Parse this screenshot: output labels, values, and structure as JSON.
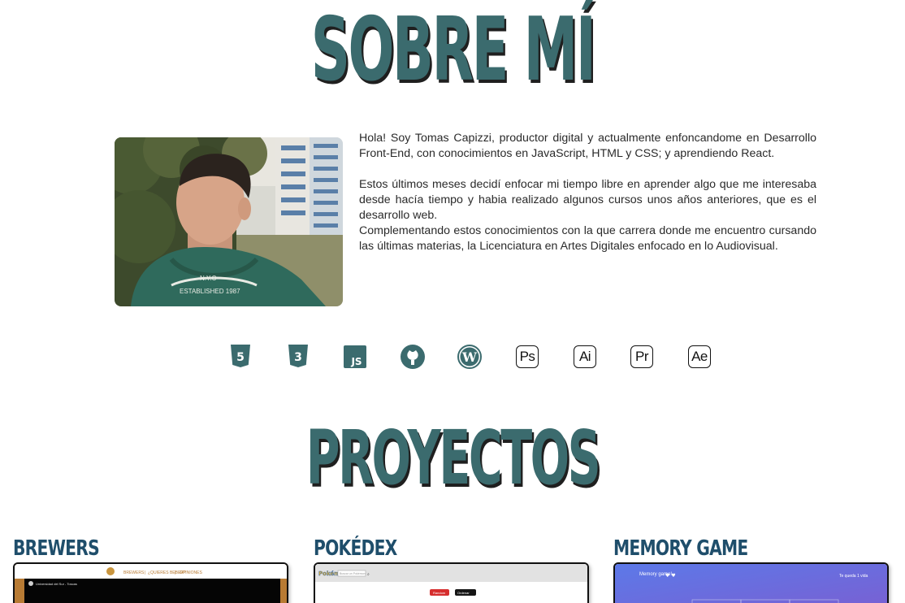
{
  "about": {
    "title": "SOBRE MÍ",
    "bio_paragraphs": [
      "Hola! Soy Tomas Capizzi, productor digital y actualmente enfoncandome en Desarrollo Front-End, con conocimientos en JavaScript, HTML y CSS; y aprendiendo React.",
      "Estos últimos meses decidí enfocar mi tiempo libre en aprender algo que me interesaba desde hacía tiempo y habia realizado algunos cursos unos años anteriores, que es el desarrollo web.",
      "Complementando estos conocimientos con la que carrera donde me encuentro cursando las últimas materias, la Licenciatura en Artes Digitales enfocado en lo Audiovisual."
    ],
    "photo_caption": {
      "line1": "N.Y.C",
      "line2": "ESTABLISHED 1987"
    }
  },
  "skills": [
    {
      "icon": "html5-icon",
      "label": "5"
    },
    {
      "icon": "css3-icon",
      "label": "3"
    },
    {
      "icon": "javascript-icon",
      "label": "JS"
    },
    {
      "icon": "github-icon",
      "label": ""
    },
    {
      "icon": "wordpress-icon",
      "label": ""
    },
    {
      "icon": "photoshop-icon",
      "label": "Ps"
    },
    {
      "icon": "illustrator-icon",
      "label": "Ai"
    },
    {
      "icon": "premiere-icon",
      "label": "Pr"
    },
    {
      "icon": "after-effects-icon",
      "label": "Ae"
    }
  ],
  "projects_section": {
    "title": "PROYECTOS",
    "projects": [
      {
        "title": "BREWERS",
        "preview": {
          "nav_items": [
            "BREWERS",
            "¿QUIERES BEBER?",
            "OPINIONES"
          ],
          "video_title": "Universidad del Sur - Toscas"
        }
      },
      {
        "title": "POKÉDEX",
        "preview": {
          "logo": "Pokémon",
          "search_placeholder": "Buscar un Pokémon",
          "buttons": [
            "Random",
            "Ordenar"
          ]
        }
      },
      {
        "title": "MEMORY GAME",
        "preview": {
          "heading": "Memory game!",
          "lives_text": "Te queda 1 vida"
        }
      }
    ]
  },
  "colors": {
    "accent": "#3b6b6e",
    "project_title": "#1f4e6b",
    "title_shadow": "#1f1f1f"
  }
}
